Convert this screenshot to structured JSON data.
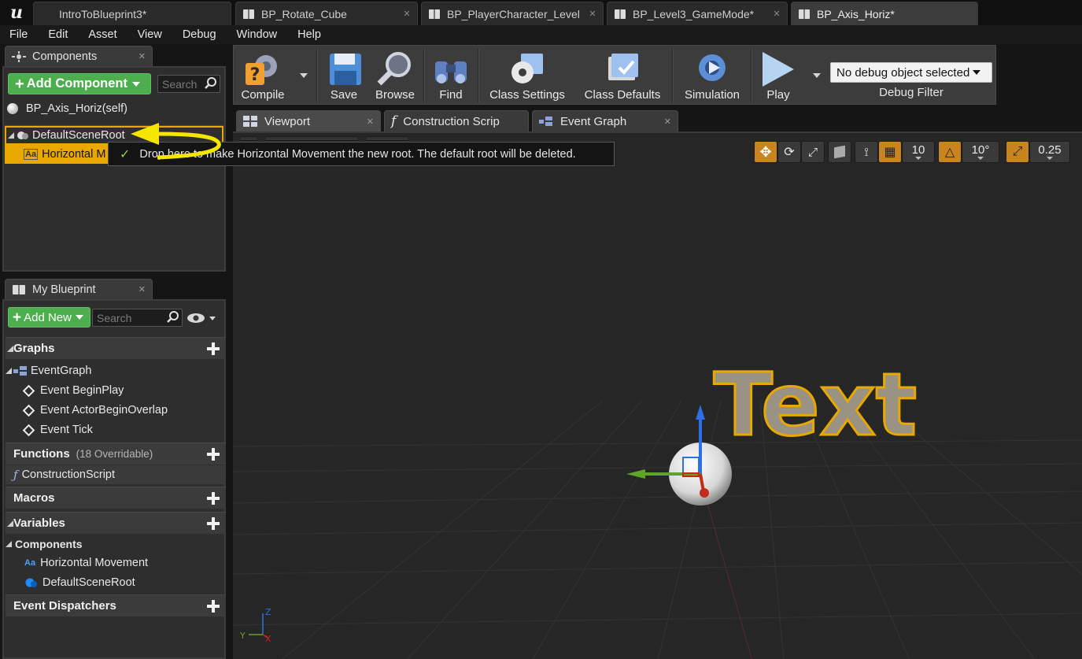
{
  "document_tabs": [
    {
      "label": "IntroToBlueprint3*"
    },
    {
      "label": "BP_Rotate_Cube"
    },
    {
      "label": "BP_PlayerCharacter_Level"
    },
    {
      "label": "BP_Level3_GameMode*"
    },
    {
      "label": "BP_Axis_Horiz*"
    }
  ],
  "menu": [
    "File",
    "Edit",
    "Asset",
    "View",
    "Debug",
    "Window",
    "Help"
  ],
  "components_panel": {
    "tab_label": "Components",
    "add_button_label": "Add Component",
    "search_placeholder": "Search",
    "self_label": "BP_Axis_Horiz(self)",
    "root_label": "DefaultSceneRoot",
    "child_label": "Horizontal M"
  },
  "tooltip": {
    "text": "Drop here to make Horizontal Movement the new root. The default root will be deleted."
  },
  "my_blueprint": {
    "tab_label": "My Blueprint",
    "add_button_label": "Add New",
    "search_placeholder": "Search",
    "graphs_label": "Graphs",
    "event_graph_label": "EventGraph",
    "events": [
      "Event BeginPlay",
      "Event ActorBeginOverlap",
      "Event Tick"
    ],
    "functions_label": "Functions",
    "functions_overridable": "(18 Overridable)",
    "construction_script_label": "ConstructionScript",
    "macros_label": "Macros",
    "variables_label": "Variables",
    "components_label": "Components",
    "component_vars": [
      "Horizontal Movement",
      "DefaultSceneRoot"
    ],
    "dispatchers_label": "Event Dispatchers"
  },
  "toolbar": {
    "compile": "Compile",
    "save": "Save",
    "browse": "Browse",
    "find": "Find",
    "class_settings": "Class Settings",
    "class_defaults": "Class Defaults",
    "simulation": "Simulation",
    "play": "Play",
    "debug_select": "No debug object selected",
    "debug_filter": "Debug Filter"
  },
  "editor_tabs": [
    "Viewport",
    "Construction Scrip",
    "Event Graph"
  ],
  "viewport": {
    "grid_snap": "10",
    "rotation_snap": "10°",
    "scale_snap": "0.25",
    "text_actor": "Text",
    "axis_z": "Z",
    "axis_y": "Y",
    "axis_x": "X"
  },
  "colors": {
    "accent_orange": "#c8841f",
    "green_button": "#4cae4c",
    "selection_yellow": "#e8a800",
    "arrow_yellow": "#f5e600"
  }
}
